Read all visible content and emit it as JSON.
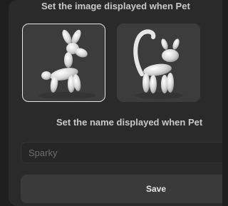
{
  "image_section": {
    "title": "Set the image displayed when Pet"
  },
  "image_options": [
    {
      "name": "balloon-dog",
      "selected": true
    },
    {
      "name": "balloon-cat",
      "selected": false
    }
  ],
  "name_section": {
    "title": "Set the name displayed when Pet",
    "placeholder": "Sparky"
  },
  "actions": {
    "save_label": "Save"
  },
  "colors": {
    "background": "#2a2a2a",
    "selected_border": "#e6e6e6",
    "tile": "#3c3c3c",
    "button": "#3a3a3a"
  }
}
